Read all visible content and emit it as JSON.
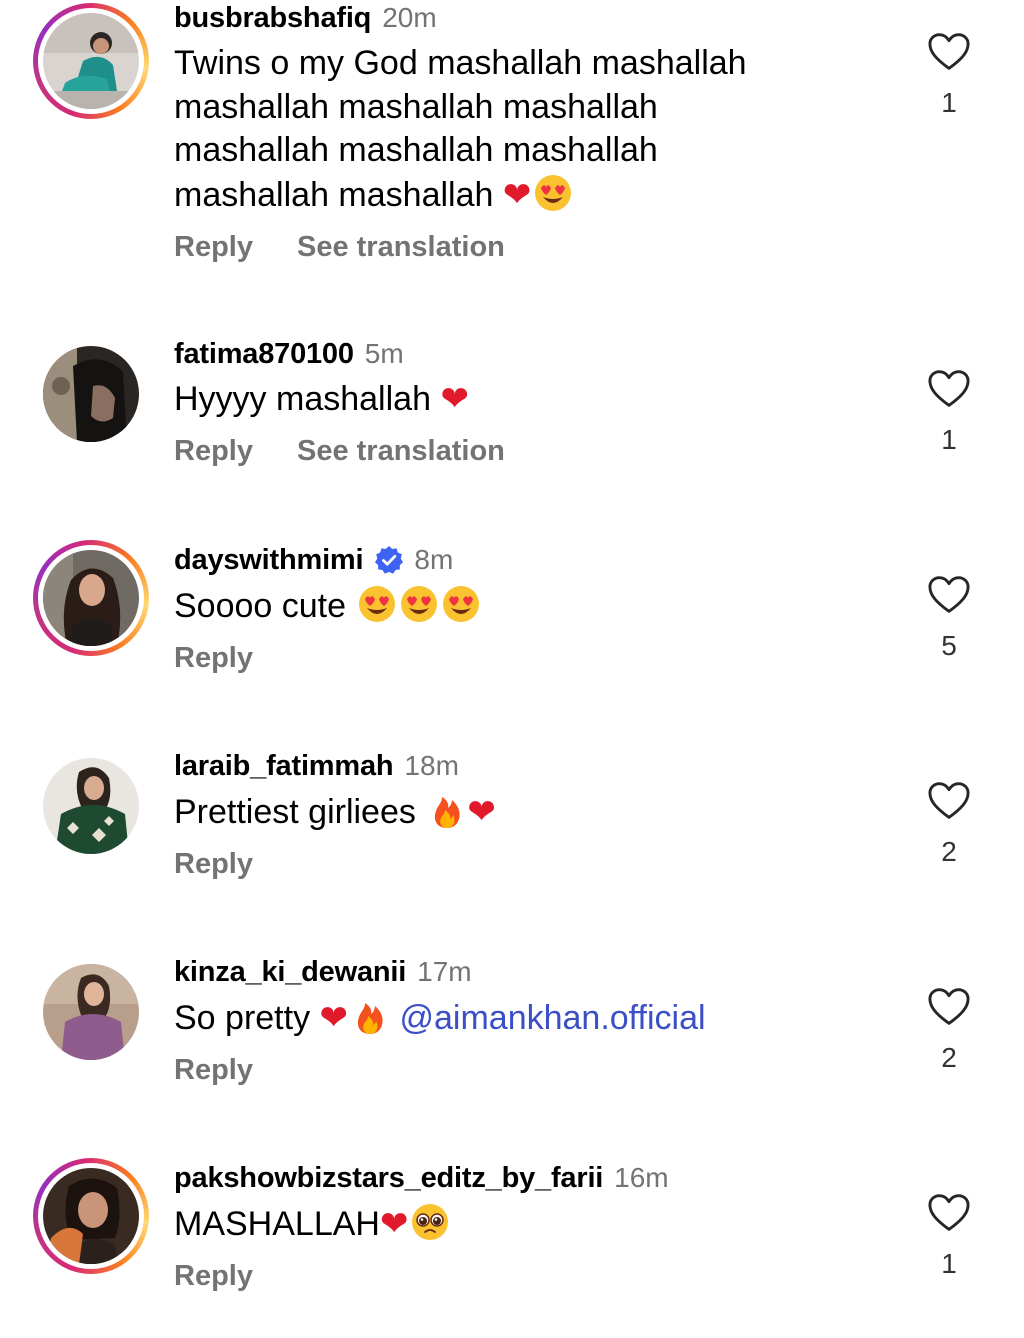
{
  "comments": [
    {
      "username": "busbrabshafiq",
      "time": "20m",
      "text": "Twins o my God mashallah mashallah\nmashallah mashallah mashallah\nmashallah mashallah mashallah\nmashallah mashallah",
      "emojis": [
        "red-heart",
        "heart-eyes"
      ],
      "actions": [
        "Reply",
        "See translation"
      ],
      "likes": "1",
      "has_story_ring": true
    },
    {
      "username": "fatima870100",
      "time": "5m",
      "text": "Hyyyy mashallah",
      "emojis": [
        "red-heart"
      ],
      "actions": [
        "Reply",
        "See translation"
      ],
      "likes": "1",
      "has_story_ring": false
    },
    {
      "username": "dayswithmimi",
      "verified": true,
      "time": "8m",
      "text": "Soooo cute",
      "emojis": [
        "heart-eyes",
        "heart-eyes",
        "heart-eyes"
      ],
      "actions": [
        "Reply"
      ],
      "likes": "5",
      "has_story_ring": true
    },
    {
      "username": "laraib_fatimmah",
      "time": "18m",
      "text": "Prettiest girliees",
      "emojis": [
        "fire",
        "red-heart"
      ],
      "actions": [
        "Reply"
      ],
      "likes": "2",
      "has_story_ring": false
    },
    {
      "username": "kinza_ki_dewanii",
      "time": "17m",
      "text": "So pretty",
      "emojis": [
        "red-heart",
        "fire"
      ],
      "mention": "@aimankhan.official",
      "actions": [
        "Reply"
      ],
      "likes": "2",
      "has_story_ring": false
    },
    {
      "username": "pakshowbizstars_editz_by_farii",
      "time": "16m",
      "text": "MASHALLAH",
      "emojis": [
        "red-heart",
        "pleading-face"
      ],
      "actions": [
        "Reply"
      ],
      "likes": "1",
      "has_story_ring": true
    }
  ],
  "colors": {
    "username": "#000000",
    "secondary_text": "#737373",
    "mention": "#3b4fc7",
    "verified_badge": "#3e63f2",
    "heart_emoji": "#e0192b"
  },
  "icons": {
    "like": "heart-outline-icon",
    "verified": "verified-badge-icon"
  }
}
